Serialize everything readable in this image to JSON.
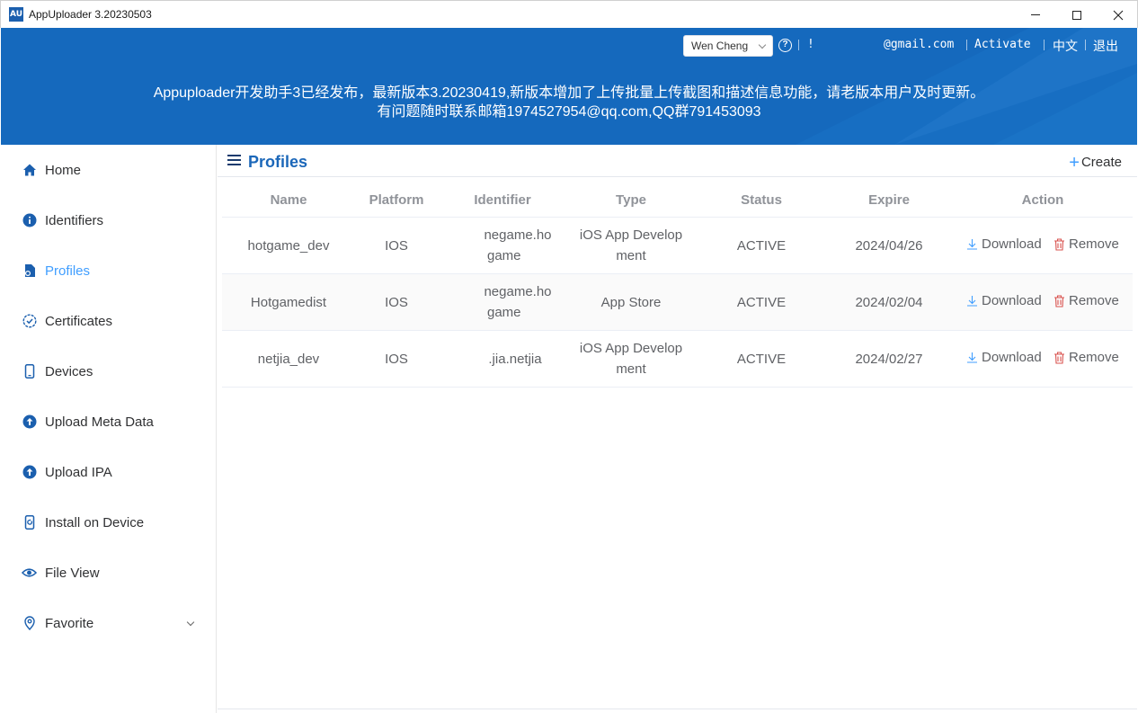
{
  "window": {
    "logo": "AU",
    "title": "AppUploader 3.20230503"
  },
  "header": {
    "user": "Wen Cheng",
    "help": "?",
    "short_link": "!",
    "email": "@gmail.com",
    "activate": "Activate",
    "lang": "中文",
    "logout": "退出",
    "notice_line1": "Appuploader开发助手3已经发布，最新版本3.20230419,新版本增加了上传批量上传截图和描述信息功能，请老版本用户及时更新。",
    "notice_line2": "有问题随时联系邮箱1974527954@qq.com,QQ群791453093"
  },
  "sidebar": {
    "items": [
      {
        "label": "Home",
        "icon": "home-icon"
      },
      {
        "label": "Identifiers",
        "icon": "info-icon"
      },
      {
        "label": "Profiles",
        "icon": "profile-icon"
      },
      {
        "label": "Certificates",
        "icon": "certificate-icon"
      },
      {
        "label": "Devices",
        "icon": "phone-icon"
      },
      {
        "label": "Upload Meta Data",
        "icon": "upload-icon"
      },
      {
        "label": "Upload IPA",
        "icon": "upload-icon"
      },
      {
        "label": "Install on Device",
        "icon": "install-icon"
      },
      {
        "label": "File View",
        "icon": "eye-icon"
      },
      {
        "label": "Favorite",
        "icon": "location-icon"
      }
    ],
    "active": "Profiles"
  },
  "page": {
    "title": "Profiles",
    "create_label": "Create"
  },
  "table": {
    "columns": [
      "Name",
      "Platform",
      "Identifier",
      "Type",
      "Status",
      "Expire",
      "Action"
    ],
    "rows": [
      {
        "name": "hotgame_dev",
        "platform": "IOS",
        "identifier_1": "negame.ho",
        "identifier_2": "game",
        "type_1": "iOS App Develop",
        "type_2": "ment",
        "status": "ACTIVE",
        "expire": "2024/04/26"
      },
      {
        "name": "Hotgamedist",
        "platform": "IOS",
        "identifier_1": "negame.ho",
        "identifier_2": "game",
        "type_1": "App Store",
        "type_2": "",
        "status": "ACTIVE",
        "expire": "2024/02/04"
      },
      {
        "name": "netjia_dev",
        "platform": "IOS",
        "identifier_1": ".jia.netjia",
        "identifier_2": "",
        "type_1": "iOS App Develop",
        "type_2": "ment",
        "status": "ACTIVE",
        "expire": "2024/02/27"
      }
    ],
    "download_label": "Download",
    "remove_label": "Remove"
  },
  "colors": {
    "header_bg": "#1569bd",
    "accent": "#409eff",
    "remove": "#d9534f"
  }
}
